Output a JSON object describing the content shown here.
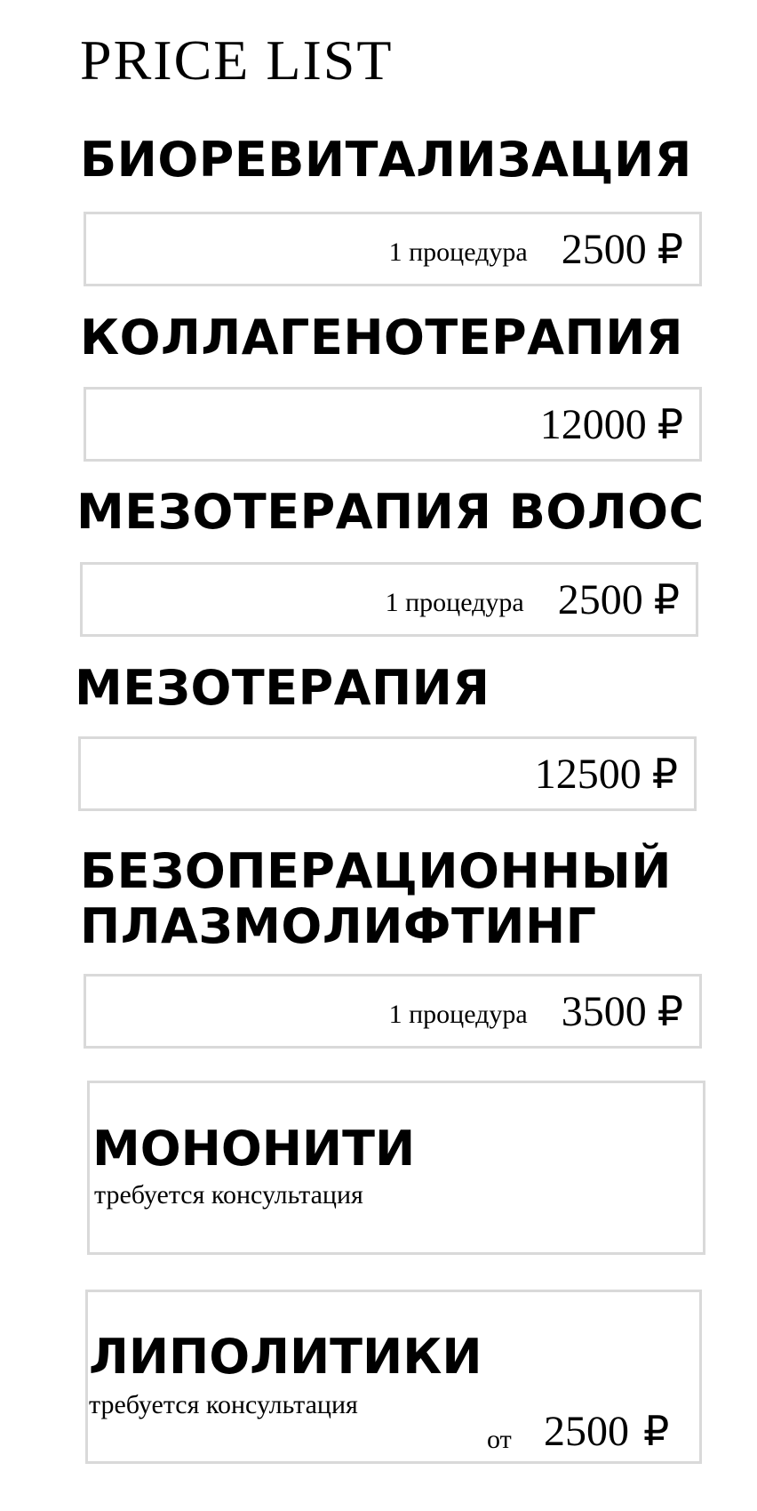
{
  "page": {
    "title": "PRICE LIST"
  },
  "sections": [
    {
      "heading": "БИОРЕВИТАЛИЗАЦИЯ",
      "unit_label": "1 процедура",
      "price": "2500",
      "currency": "₽"
    },
    {
      "heading": "КОЛЛАГЕНОТЕРАПИЯ",
      "price": "12000",
      "currency": "₽"
    },
    {
      "heading": "МЕЗОТЕРАПИЯ ВОЛОС",
      "unit_label": "1 процедура",
      "price": "2500",
      "currency": "₽"
    },
    {
      "heading": "МЕЗОТЕРАПИЯ",
      "price": "12500",
      "currency": "₽"
    },
    {
      "heading_line1": "БЕЗОПЕРАЦИОННЫЙ",
      "heading_line2": "ПЛАЗМОЛИФТИНГ",
      "unit_label": "1 процедура",
      "price": "3500",
      "currency": "₽"
    }
  ],
  "cards": [
    {
      "title": "МОНОНИТИ",
      "note": "требуется консультация"
    },
    {
      "title": "ЛИПОЛИТИКИ",
      "note": "требуется консультация",
      "from_label": "от",
      "price": "2500",
      "currency": "₽"
    }
  ]
}
